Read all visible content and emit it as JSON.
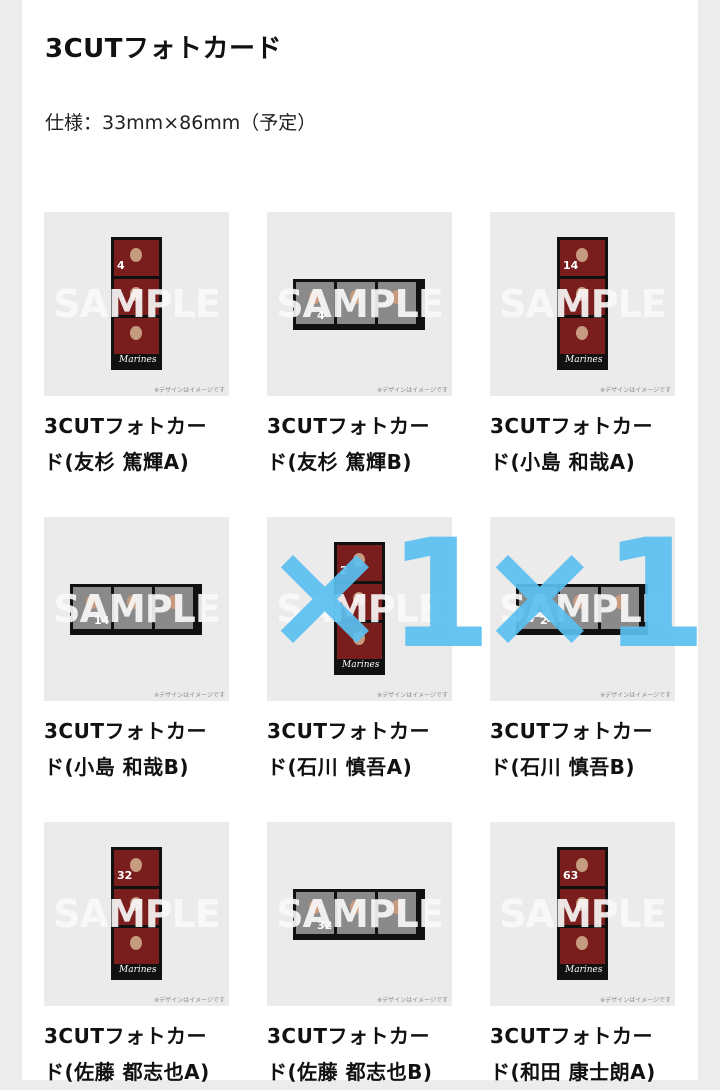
{
  "header": {
    "title": "3CUTフォトカード",
    "spec": "仕様：33mm×86mm（予定）"
  },
  "watermark": "SAMPLE",
  "image_note": "※デザインはイメージです",
  "overlay_mark": "×1",
  "items": [
    {
      "line1": "3CUTフォトカー",
      "line2": "ド(友杉 篤輝A)",
      "number": "4",
      "layout": "vertical"
    },
    {
      "line1": "3CUTフォトカー",
      "line2": "ド(友杉 篤輝B)",
      "number": "4",
      "layout": "horizontal"
    },
    {
      "line1": "3CUTフォトカー",
      "line2": "ド(小島 和哉A)",
      "number": "14",
      "layout": "vertical"
    },
    {
      "line1": "3CUTフォトカー",
      "line2": "ド(小島 和哉B)",
      "number": "14",
      "layout": "horizontal"
    },
    {
      "line1": "3CUTフォトカー",
      "line2": "ド(石川 慎吾A)",
      "number": "2",
      "layout": "vertical"
    },
    {
      "line1": "3CUTフォトカー",
      "line2": "ド(石川 慎吾B)",
      "number": "2",
      "layout": "horizontal"
    },
    {
      "line1": "3CUTフォトカー",
      "line2": "ド(佐藤 都志也A)",
      "number": "32",
      "layout": "vertical"
    },
    {
      "line1": "3CUTフォトカー",
      "line2": "ド(佐藤 都志也B)",
      "number": "32",
      "layout": "horizontal"
    },
    {
      "line1": "3CUTフォトカー",
      "line2": "ド(和田 康士朗A)",
      "number": "63",
      "layout": "vertical"
    }
  ]
}
